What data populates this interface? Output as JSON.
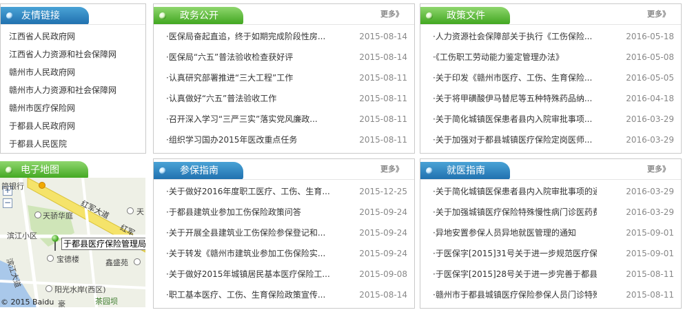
{
  "links_panel": {
    "title": "友情链接",
    "items": [
      "江西省人民政府网",
      "江西省人力资源和社会保障网",
      "赣州市人民政府网",
      "赣州市人力资源和社会保障网",
      "赣州市医疗保险网",
      "于都县人民政府网",
      "于都县人民医院"
    ]
  },
  "map_panel": {
    "title": "电子地图",
    "zoom_in": "+",
    "zoom_out": "−",
    "callout": "于都县医疗保险管理局",
    "road_main": "红军大道",
    "road_main2": "红军",
    "road_river": "滨江大道",
    "labels": [
      "简银行",
      "天骄华庭",
      "滨江小区",
      "宝德楼",
      "鑫盛苑",
      "阳光水岸(西区)",
      "茶园坝",
      "豪"
    ],
    "small_label": "天",
    "copyright": "© 2015 Baidu"
  },
  "politics": {
    "title": "政务公开",
    "more": "更多》",
    "items": [
      {
        "t": "·医保局奋起直追，终于如期完成阶段性房...",
        "d": "2015-08-14"
      },
      {
        "t": "·医保局“六五”普法验收检查获好评",
        "d": "2015-08-14"
      },
      {
        "t": "·认真研究部署推进“三大工程”工作",
        "d": "2015-08-11"
      },
      {
        "t": "·认真做好“六五”普法验收工作",
        "d": "2015-08-11"
      },
      {
        "t": "·召开深入学习“三严三实”落实党风廉政...",
        "d": "2015-08-11"
      },
      {
        "t": "·组织学习国办2015年医改重点任务",
        "d": "2015-08-11"
      }
    ]
  },
  "policy": {
    "title": "政策文件",
    "more": "更多》",
    "items": [
      {
        "t": "·人力资源社会保障部关于执行《工伤保险...",
        "d": "2016-05-18"
      },
      {
        "t": "·《工伤职工劳动能力鉴定管理办法》",
        "d": "2016-05-08"
      },
      {
        "t": "·关于印发《赣州市医疗、工伤、生育保险...",
        "d": "2016-05-05"
      },
      {
        "t": "·关于将甲磺酸伊马替尼等五种特殊药品纳...",
        "d": "2016-04-18"
      },
      {
        "t": "·关于简化城镇医保患者县内入院审批事项...",
        "d": "2016-03-29"
      },
      {
        "t": "·关于加强对于都县城镇医疗保险定岗医师...",
        "d": "2016-03-29"
      }
    ]
  },
  "insure": {
    "title": "参保指南",
    "more": "更多》",
    "items": [
      {
        "t": "·关于做好2016年度职工医疗、工伤、生育...",
        "d": "2015-12-25"
      },
      {
        "t": "·于都县建筑业参加工伤保险政策问答",
        "d": "2015-09-24"
      },
      {
        "t": "·关于开展全县建筑业工伤保险参保登记和...",
        "d": "2015-09-24"
      },
      {
        "t": "·关于转发《赣州市建筑业参加工伤保险实...",
        "d": "2015-09-24"
      },
      {
        "t": "·关于做好2015年城镇居民基本医疗保险工...",
        "d": "2015-09-08"
      },
      {
        "t": "·职工基本医疗、工伤、生育保险政策宣传...",
        "d": "2015-08-14"
      }
    ]
  },
  "medical": {
    "title": "就医指南",
    "more": "更多》",
    "items": [
      {
        "t": "·关于简化城镇医保患者县内入院审批事项的通...",
        "d": "2016-03-29"
      },
      {
        "t": "·关于加强城镇医疗保险特殊慢性病门诊医药费...",
        "d": "2016-03-29"
      },
      {
        "t": "·异地安置参保人员异地就医管理的通知",
        "d": "2015-09-01"
      },
      {
        "t": "·于医保字[2015]31号关于进一步规范医疗保险...",
        "d": "2015-09-01"
      },
      {
        "t": "·于医保字[2015]28号关于进一步完善于都县医...",
        "d": "2015-08-11"
      },
      {
        "t": "·赣州市于都县城镇医疗保险参保人员门诊特殊...",
        "d": "2015-08-11"
      }
    ]
  }
}
